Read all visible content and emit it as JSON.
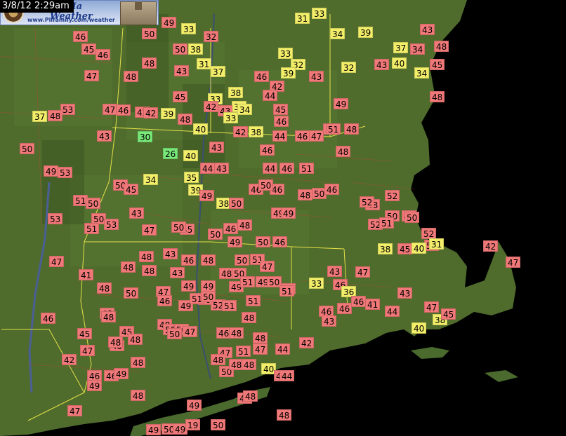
{
  "timestamp": "3/8/12 2:29am",
  "logo": {
    "title_line1": "ford, Ma",
    "title_line2": "Weather",
    "url": "www.Pllfamily.com/weather"
  },
  "colors": {
    "red": "#f07878",
    "orange": "#f2a05a",
    "yellow": "#f2ee6a",
    "green": "#78e878",
    "ocean": "#000000",
    "land": "#4d6b2e",
    "border": "#e6e04a"
  },
  "stations": [
    {
      "v": "49",
      "c": "red"
    },
    {
      "v": "33",
      "c": "yellow"
    },
    {
      "v": "32",
      "c": "red"
    },
    {
      "v": "31",
      "c": "yellow"
    },
    {
      "v": "33",
      "c": "yellow"
    },
    {
      "v": "34",
      "c": "yellow"
    },
    {
      "v": "39",
      "c": "yellow"
    },
    {
      "v": "43",
      "c": "red"
    },
    {
      "v": "46",
      "c": "red"
    },
    {
      "v": "45",
      "c": "red"
    },
    {
      "v": "46",
      "c": "red"
    },
    {
      "v": "50",
      "c": "red"
    },
    {
      "v": "48",
      "c": "red"
    },
    {
      "v": "50",
      "c": "red"
    },
    {
      "v": "38",
      "c": "yellow"
    },
    {
      "v": "33",
      "c": "yellow"
    },
    {
      "v": "37",
      "c": "yellow"
    },
    {
      "v": "34",
      "c": "red"
    },
    {
      "v": "40",
      "c": "yellow"
    },
    {
      "v": "34",
      "c": "yellow"
    },
    {
      "v": "48",
      "c": "red"
    },
    {
      "v": "47",
      "c": "red"
    },
    {
      "v": "48",
      "c": "red"
    },
    {
      "v": "43",
      "c": "red"
    },
    {
      "v": "31",
      "c": "yellow"
    },
    {
      "v": "37",
      "c": "yellow"
    },
    {
      "v": "46",
      "c": "red"
    },
    {
      "v": "43",
      "c": "red"
    },
    {
      "v": "32",
      "c": "yellow"
    },
    {
      "v": "32",
      "c": "yellow"
    },
    {
      "v": "43",
      "c": "red"
    },
    {
      "v": "39",
      "c": "yellow"
    },
    {
      "v": "45",
      "c": "red"
    },
    {
      "v": "45",
      "c": "red"
    },
    {
      "v": "38",
      "c": "yellow"
    },
    {
      "v": "42",
      "c": "red"
    },
    {
      "v": "44",
      "c": "red"
    },
    {
      "v": "33",
      "c": "yellow"
    },
    {
      "v": "42",
      "c": "red"
    },
    {
      "v": "33",
      "c": "yellow"
    },
    {
      "v": "48",
      "c": "red"
    },
    {
      "v": "53",
      "c": "red"
    },
    {
      "v": "37",
      "c": "yellow"
    },
    {
      "v": "47",
      "c": "red"
    },
    {
      "v": "46",
      "c": "red"
    },
    {
      "v": "42",
      "c": "red"
    },
    {
      "v": "39",
      "c": "yellow"
    },
    {
      "v": "43",
      "c": "red"
    },
    {
      "v": "34",
      "c": "yellow"
    },
    {
      "v": "45",
      "c": "red"
    },
    {
      "v": "49",
      "c": "red"
    },
    {
      "v": "46",
      "c": "red"
    },
    {
      "v": "48",
      "c": "red"
    },
    {
      "v": "42",
      "c": "red"
    },
    {
      "v": "48",
      "c": "red"
    },
    {
      "v": "40",
      "c": "yellow"
    },
    {
      "v": "33",
      "c": "yellow"
    },
    {
      "v": "51",
      "c": "red"
    },
    {
      "v": "48",
      "c": "red"
    },
    {
      "v": "43",
      "c": "red"
    },
    {
      "v": "30",
      "c": "green"
    },
    {
      "v": "42",
      "c": "red"
    },
    {
      "v": "38",
      "c": "yellow"
    },
    {
      "v": "44",
      "c": "red"
    },
    {
      "v": "47",
      "c": "red"
    },
    {
      "v": "46",
      "c": "red"
    },
    {
      "v": "51",
      "c": "red"
    },
    {
      "v": "50",
      "c": "red"
    },
    {
      "v": "26",
      "c": "green"
    },
    {
      "v": "40",
      "c": "yellow"
    },
    {
      "v": "43",
      "c": "red"
    },
    {
      "v": "46",
      "c": "red"
    },
    {
      "v": "44",
      "c": "red"
    },
    {
      "v": "46",
      "c": "red"
    },
    {
      "v": "51",
      "c": "red"
    },
    {
      "v": "48",
      "c": "red"
    },
    {
      "v": "49",
      "c": "red"
    },
    {
      "v": "53",
      "c": "red"
    },
    {
      "v": "35",
      "c": "yellow"
    },
    {
      "v": "44",
      "c": "red"
    },
    {
      "v": "43",
      "c": "red"
    },
    {
      "v": "46",
      "c": "red"
    },
    {
      "v": "46",
      "c": "red"
    },
    {
      "v": "48",
      "c": "red"
    },
    {
      "v": "50",
      "c": "red"
    },
    {
      "v": "52",
      "c": "red"
    },
    {
      "v": "50",
      "c": "red"
    },
    {
      "v": "34",
      "c": "yellow"
    },
    {
      "v": "39",
      "c": "yellow"
    },
    {
      "v": "49",
      "c": "red"
    },
    {
      "v": "45",
      "c": "red"
    },
    {
      "v": "46",
      "c": "red"
    },
    {
      "v": "48",
      "c": "red"
    },
    {
      "v": "50",
      "c": "red"
    },
    {
      "v": "49",
      "c": "red"
    },
    {
      "v": "51",
      "c": "red"
    },
    {
      "v": "50",
      "c": "red"
    },
    {
      "v": "43",
      "c": "red"
    },
    {
      "v": "38",
      "c": "yellow"
    },
    {
      "v": "50",
      "c": "red"
    },
    {
      "v": "50",
      "c": "red"
    },
    {
      "v": "52",
      "c": "red"
    },
    {
      "v": "50",
      "c": "red"
    },
    {
      "v": "53",
      "c": "red"
    },
    {
      "v": "50",
      "c": "red"
    },
    {
      "v": "53",
      "c": "red"
    },
    {
      "v": "45",
      "c": "red"
    },
    {
      "v": "46",
      "c": "red"
    },
    {
      "v": "48",
      "c": "red"
    },
    {
      "v": "52",
      "c": "red"
    },
    {
      "v": "51",
      "c": "red"
    },
    {
      "v": "52",
      "c": "red"
    },
    {
      "v": "51",
      "c": "red"
    },
    {
      "v": "47",
      "c": "red"
    },
    {
      "v": "50",
      "c": "red"
    },
    {
      "v": "50",
      "c": "red"
    },
    {
      "v": "49",
      "c": "red"
    },
    {
      "v": "50",
      "c": "red"
    },
    {
      "v": "46",
      "c": "red"
    },
    {
      "v": "49",
      "c": "red"
    },
    {
      "v": "50",
      "c": "red"
    },
    {
      "v": "31",
      "c": "yellow"
    },
    {
      "v": "42",
      "c": "red"
    },
    {
      "v": "47",
      "c": "red"
    },
    {
      "v": "48",
      "c": "red"
    },
    {
      "v": "43",
      "c": "red"
    },
    {
      "v": "46",
      "c": "red"
    },
    {
      "v": "48",
      "c": "red"
    },
    {
      "v": "50",
      "c": "red"
    },
    {
      "v": "51",
      "c": "red"
    },
    {
      "v": "49",
      "c": "red"
    },
    {
      "v": "38",
      "c": "yellow"
    },
    {
      "v": "45",
      "c": "red"
    },
    {
      "v": "40",
      "c": "yellow"
    },
    {
      "v": "41",
      "c": "red"
    },
    {
      "v": "48",
      "c": "red"
    },
    {
      "v": "48",
      "c": "red"
    },
    {
      "v": "43",
      "c": "red"
    },
    {
      "v": "48",
      "c": "red"
    },
    {
      "v": "50",
      "c": "red"
    },
    {
      "v": "47",
      "c": "red"
    },
    {
      "v": "43",
      "c": "red"
    },
    {
      "v": "47",
      "c": "red"
    },
    {
      "v": "48",
      "c": "red"
    },
    {
      "v": "47",
      "c": "red"
    },
    {
      "v": "49",
      "c": "red"
    },
    {
      "v": "49",
      "c": "red"
    },
    {
      "v": "49",
      "c": "red"
    },
    {
      "v": "51",
      "c": "red"
    },
    {
      "v": "49",
      "c": "red"
    },
    {
      "v": "50",
      "c": "red"
    },
    {
      "v": "45",
      "c": "red"
    },
    {
      "v": "33",
      "c": "yellow"
    },
    {
      "v": "47",
      "c": "red"
    },
    {
      "v": "48",
      "c": "red"
    },
    {
      "v": "50",
      "c": "red"
    },
    {
      "v": "46",
      "c": "red"
    },
    {
      "v": "49",
      "c": "red"
    },
    {
      "v": "50",
      "c": "red"
    },
    {
      "v": "52",
      "c": "red"
    },
    {
      "v": "51",
      "c": "red"
    },
    {
      "v": "51",
      "c": "red"
    },
    {
      "v": "46",
      "c": "red"
    },
    {
      "v": "36",
      "c": "yellow"
    },
    {
      "v": "43",
      "c": "red"
    },
    {
      "v": "44",
      "c": "red"
    },
    {
      "v": "46",
      "c": "red"
    },
    {
      "v": "48",
      "c": "red"
    },
    {
      "v": "45",
      "c": "red"
    },
    {
      "v": "48",
      "c": "red"
    },
    {
      "v": "50",
      "c": "red"
    },
    {
      "v": "50",
      "c": "red"
    },
    {
      "v": "51",
      "c": "red"
    },
    {
      "v": "50",
      "c": "red"
    },
    {
      "v": "51",
      "c": "red"
    },
    {
      "v": "48",
      "c": "red"
    },
    {
      "v": "46",
      "c": "red"
    },
    {
      "v": "46",
      "c": "red"
    },
    {
      "v": "41",
      "c": "red"
    },
    {
      "v": "40",
      "c": "yellow"
    },
    {
      "v": "45",
      "c": "red"
    },
    {
      "v": "47",
      "c": "red"
    },
    {
      "v": "45",
      "c": "red"
    },
    {
      "v": "48",
      "c": "red"
    },
    {
      "v": "50",
      "c": "red"
    },
    {
      "v": "47",
      "c": "red"
    },
    {
      "v": "46",
      "c": "red"
    },
    {
      "v": "48",
      "c": "red"
    },
    {
      "v": "48",
      "c": "red"
    },
    {
      "v": "46",
      "c": "red"
    },
    {
      "v": "47",
      "c": "red"
    },
    {
      "v": "38",
      "c": "yellow"
    },
    {
      "v": "45",
      "c": "red"
    },
    {
      "v": "42",
      "c": "red"
    },
    {
      "v": "48",
      "c": "red"
    },
    {
      "v": "48",
      "c": "red"
    },
    {
      "v": "47",
      "c": "red"
    },
    {
      "v": "51",
      "c": "red"
    },
    {
      "v": "47",
      "c": "red"
    },
    {
      "v": "44",
      "c": "red"
    },
    {
      "v": "42",
      "c": "red"
    },
    {
      "v": "43",
      "c": "red"
    },
    {
      "v": "46",
      "c": "red"
    },
    {
      "v": "46",
      "c": "red"
    },
    {
      "v": "49",
      "c": "red"
    },
    {
      "v": "48",
      "c": "red"
    },
    {
      "v": "50",
      "c": "red"
    },
    {
      "v": "48",
      "c": "red"
    },
    {
      "v": "48",
      "c": "red"
    },
    {
      "v": "40",
      "c": "yellow"
    },
    {
      "v": "47",
      "c": "red"
    },
    {
      "v": "44",
      "c": "red"
    },
    {
      "v": "49",
      "c": "red"
    },
    {
      "v": "48",
      "c": "red"
    },
    {
      "v": "49",
      "c": "red"
    },
    {
      "v": "47",
      "c": "red"
    },
    {
      "v": "48",
      "c": "red"
    },
    {
      "v": "48",
      "c": "red"
    },
    {
      "v": "47",
      "c": "red"
    },
    {
      "v": "49",
      "c": "red"
    },
    {
      "v": "50",
      "c": "red"
    },
    {
      "v": "49",
      "c": "red"
    },
    {
      "v": "19",
      "c": "red"
    },
    {
      "v": "50",
      "c": "red"
    }
  ]
}
